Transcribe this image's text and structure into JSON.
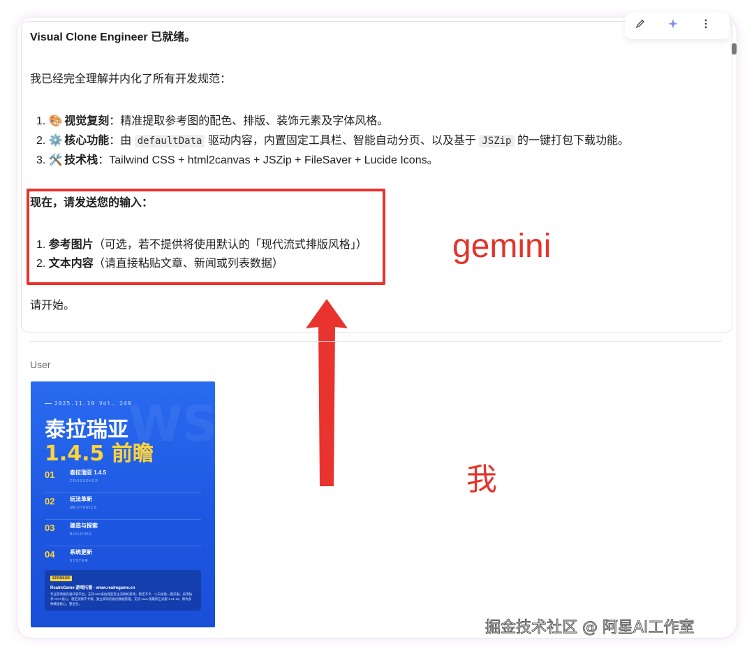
{
  "response": {
    "title_name": "Visual Clone Engineer",
    "title_suffix": " 已就绪。",
    "intro": "我已经完全理解并内化了所有开发规范：",
    "list": [
      {
        "emoji": "🎨",
        "label": "视觉复刻",
        "text": "：精准提取参考图的配色、排版、装饰元素及字体风格。"
      },
      {
        "emoji": "⚙️",
        "label": "核心功能",
        "text_a": "：由 ",
        "code1": "defaultData",
        "text_b": " 驱动内容，内置固定工具栏、智能自动分页、以及基于 ",
        "code2": "JSZip",
        "text_c": " 的一键打包下载功能。"
      },
      {
        "emoji": "🛠️",
        "label": "技术栈",
        "text": "：Tailwind CSS + html2canvas + JSZip + FileSaver + Lucide Icons。"
      }
    ],
    "now_send": "现在，请发送您的输入：",
    "inputs": [
      {
        "label": "参考图片",
        "text": "（可选，若不提供将使用默认的「现代流式排版风格」）"
      },
      {
        "label": "文本内容",
        "text": "（请直接粘贴文章、新闻或列表数据）"
      }
    ],
    "begin": "请开始。"
  },
  "annotations": {
    "gemini": "gemini",
    "me": "我"
  },
  "user_label": "User",
  "poster": {
    "date": "2025.11.19 Vol. 249",
    "ghost": "WS",
    "title1": "泰拉瑞亚",
    "title2": "1.4.5 前瞻",
    "items": [
      {
        "num": "01",
        "title": "泰拉瑞亚 1.4.5",
        "sub": "CROSSOVER"
      },
      {
        "num": "02",
        "title": "玩法革新",
        "sub": "MECHANICS"
      },
      {
        "num": "03",
        "title": "建造与探索",
        "sub": "BUILDING"
      },
      {
        "num": "04",
        "title": "系统更新",
        "sub": "SYSTEM"
      }
    ],
    "sponsor_tag": "SPONSOR",
    "sponsor_title": "RealmGame 游戏托管 · www.realmgame.cn",
    "sponsor_desc": "专业游戏服务器托管平台，支持 MC/泰拉瑞亚等主流联机游戏，稳定不卡，小白也能一键开服。采用独享 CPU 核心，稳定流畅不卡顿。独立高效的备份数据管理，支持 Java 版最新正式版 1.21.10，帮你多种模组核心，整合包。"
  },
  "watermark": "掘金技术社区 @ 阿星AI工作室",
  "colors": {
    "annotation_red": "#e5332a",
    "poster_blue": "#1c56e0",
    "poster_yellow": "#ffd43b"
  }
}
